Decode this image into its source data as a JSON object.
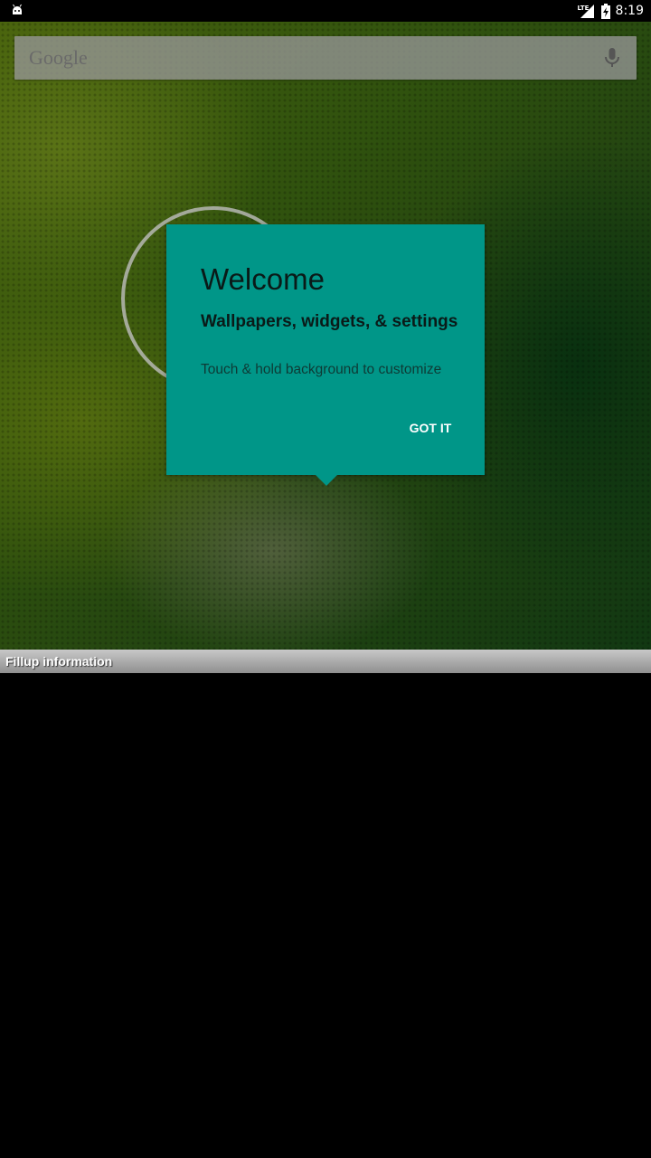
{
  "status_bar": {
    "time": "8:19",
    "network_label": "LTE",
    "icons": [
      "android-debug-icon",
      "signal-icon",
      "battery-charging-icon"
    ]
  },
  "search": {
    "logo_text": "Google",
    "icon": "mic-icon"
  },
  "cling": {
    "title": "Welcome",
    "subtitle": "Wallpapers, widgets, & settings",
    "body": "Touch & hold background to customize",
    "button_label": "GOT IT",
    "background_color": "#009688"
  },
  "fillup": {
    "label": "Fillup information"
  }
}
